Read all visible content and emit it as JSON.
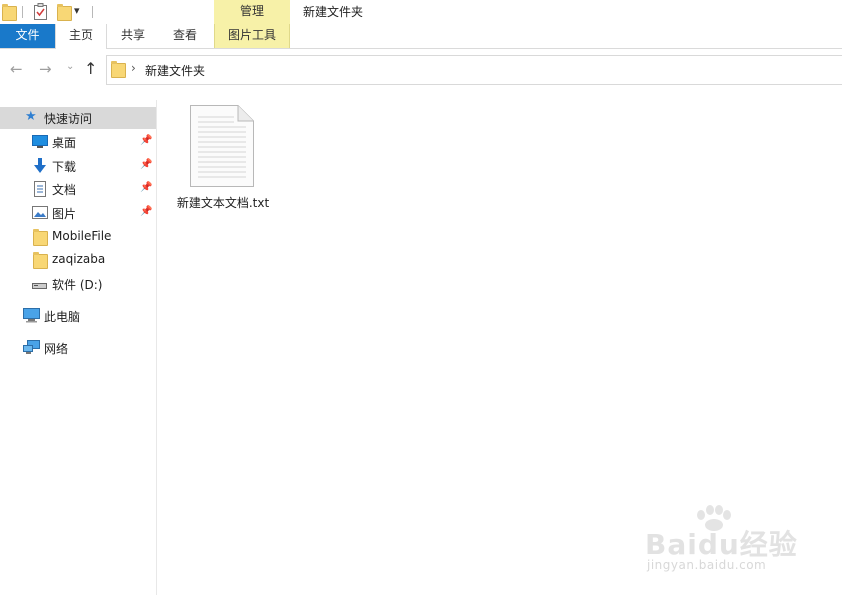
{
  "window": {
    "title": "新建文件夹"
  },
  "ribbon": {
    "context_group": "管理",
    "tabs": [
      {
        "label": "文件"
      },
      {
        "label": "主页"
      },
      {
        "label": "共享"
      },
      {
        "label": "查看"
      },
      {
        "label": "图片工具"
      }
    ],
    "colors": {
      "file_tab": "#1979ca",
      "context": "#f7f1a8"
    }
  },
  "address_bar": {
    "path_segment": "新建文件夹"
  },
  "sidebar": {
    "quick_access": {
      "label": "快速访问",
      "icon": "star-icon"
    },
    "items": [
      {
        "label": "桌面",
        "icon": "desktop-icon",
        "pinned": true
      },
      {
        "label": "下载",
        "icon": "download-icon",
        "pinned": true
      },
      {
        "label": "文档",
        "icon": "documents-icon",
        "pinned": true
      },
      {
        "label": "图片",
        "icon": "pictures-icon",
        "pinned": true
      },
      {
        "label": "MobileFile",
        "icon": "folder-icon",
        "pinned": false
      },
      {
        "label": "zaqizaba",
        "icon": "folder-icon",
        "pinned": false
      },
      {
        "label": "软件 (D:)",
        "icon": "drive-icon",
        "pinned": false
      }
    ],
    "this_pc": {
      "label": "此电脑",
      "icon": "computer-icon"
    },
    "network": {
      "label": "网络",
      "icon": "network-icon"
    }
  },
  "files": [
    {
      "name": "新建文本文档.txt",
      "icon": "text-file-icon"
    }
  ],
  "watermark": {
    "main": "Baidu经验",
    "sub": "jingyan.baidu.com"
  }
}
